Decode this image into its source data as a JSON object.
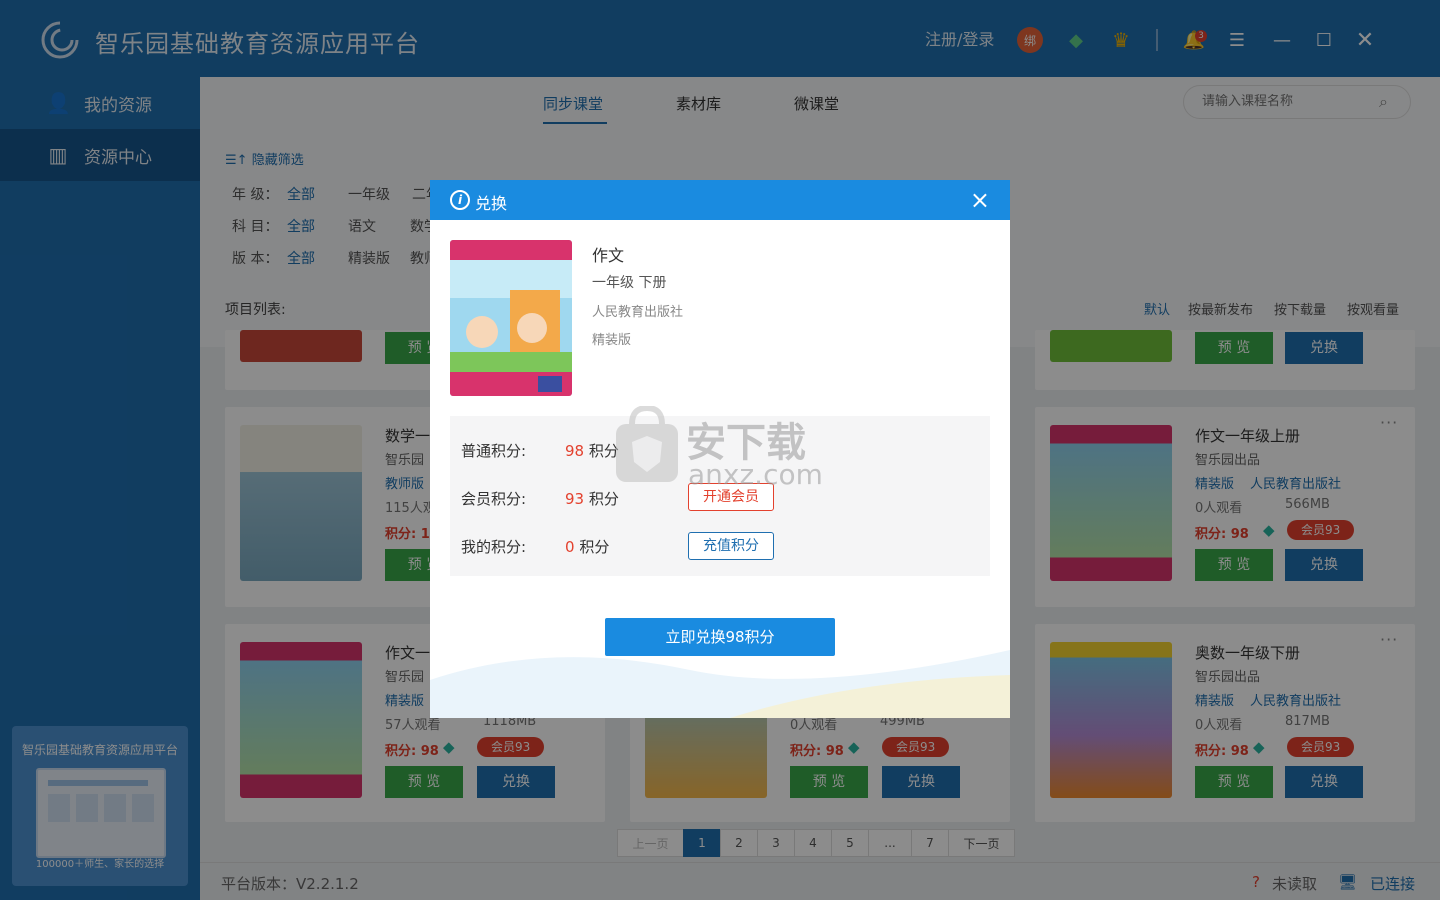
{
  "app": {
    "title": "智乐园基础教育资源应用平台",
    "login": "注册/登录",
    "bind_badge": "绑",
    "notif_count": "3"
  },
  "sidebar": {
    "items": [
      {
        "label": "我的资源"
      },
      {
        "label": "资源中心"
      }
    ],
    "promo_title": "智乐园基础教育资源应用平台",
    "promo_tagline": "100000＋师生、家长的选择"
  },
  "tabs": [
    {
      "label": "同步课堂"
    },
    {
      "label": "素材库"
    },
    {
      "label": "微课堂"
    }
  ],
  "search": {
    "placeholder": "请输入课程名称"
  },
  "filters": {
    "toggle": "隐藏筛选",
    "grade_label": "年 级：",
    "subject_label": "科 目：",
    "edition_label": "版 本：",
    "all": "全部",
    "grade_opts": [
      "一年级",
      "二年"
    ],
    "subject_opts": [
      "语文",
      "数学"
    ],
    "edition_opts": [
      "精装版",
      "教师"
    ]
  },
  "list": {
    "label": "项目列表:",
    "sort": [
      "默认",
      "按最新发布",
      "按下载量",
      "按观看量"
    ]
  },
  "cards": [
    {
      "title": "数学一",
      "org": "智乐园",
      "tag": "教师版",
      "meta": "115人观",
      "pts": "积分: 1"
    },
    {
      "title": "作文一年级上册",
      "org": "智乐园出品",
      "tag": "精装版",
      "pub": "人民教育出版社",
      "views": "0人观看",
      "size": "566MB",
      "pts": "积分: 98",
      "vip": "会员93"
    },
    {
      "title": "作文一",
      "org": "智乐园",
      "tag": "精装版",
      "views": "57人观看",
      "size": "1118MB",
      "pts": "积分: 98",
      "vip": "会员93"
    },
    {
      "views": "0人观看",
      "size": "499MB",
      "pts": "积分: 98",
      "vip": "会员93"
    },
    {
      "title": "奥数一年级下册",
      "org": "智乐园出品",
      "tag": "精装版",
      "pub": "人民教育出版社",
      "views": "0人观看",
      "size": "817MB",
      "pts": "积分: 98",
      "vip": "会员93"
    }
  ],
  "buttons": {
    "preview": "预 览",
    "exchange": "兑换"
  },
  "pager": {
    "prev": "上一页",
    "pages": [
      "1",
      "2",
      "3",
      "4",
      "5",
      "...",
      "7"
    ],
    "next": "下一页"
  },
  "status": {
    "version": "平台版本：V2.2.1.2",
    "unread": "未读取",
    "connected": "已连接"
  },
  "dialog": {
    "title": "兑换",
    "book_name": "作文",
    "grade": "一年级 下册",
    "publisher": "人民教育出版社",
    "edition": "精装版",
    "normal_label": "普通积分:",
    "normal_value": "98",
    "vip_label": "会员积分:",
    "vip_value": "93",
    "mine_label": "我的积分:",
    "mine_value": "0",
    "unit": "积分",
    "open_vip": "开通会员",
    "recharge": "充值积分",
    "confirm": "立即兑换98积分"
  },
  "watermark": {
    "text": "安下载",
    "url": "anxz.com"
  },
  "colors": {
    "brand": "#1f6fb0",
    "accent": "#1a8be0",
    "green": "#3aa84a",
    "red": "#e3412e"
  }
}
